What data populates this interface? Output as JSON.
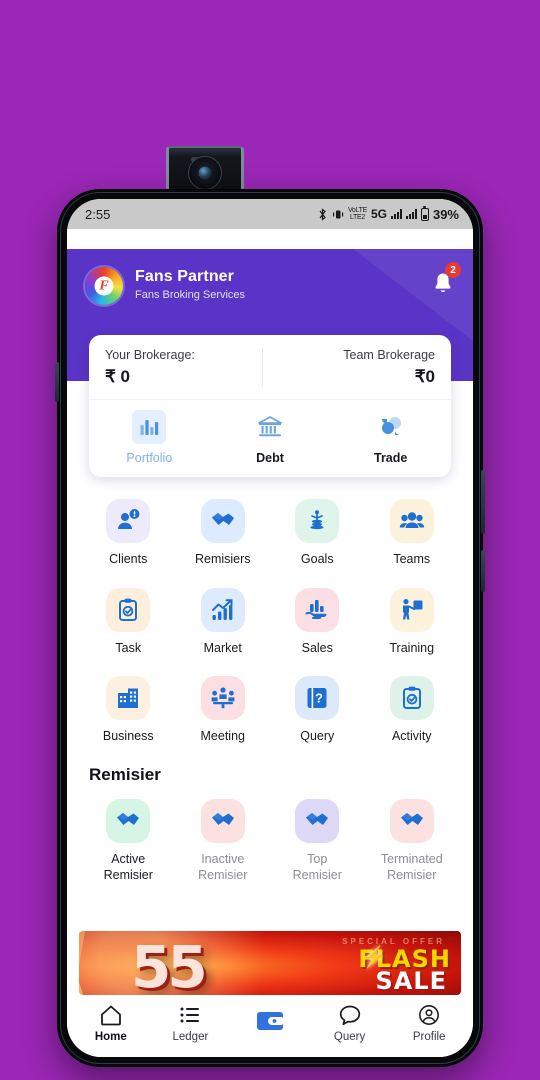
{
  "wallpaper_color": "#9A27B5",
  "statusbar": {
    "time": "2:55",
    "battery_pct": "39%",
    "network": "5G",
    "lte_label": "VoLTE",
    "icons": [
      "bluetooth-icon",
      "vibrate-icon",
      "volte-icon",
      "signal-icon",
      "signal-icon",
      "battery-icon"
    ]
  },
  "header": {
    "app_name": "Fans Partner",
    "subtitle": "Fans Broking Services",
    "logo_letter": "F",
    "notification_count": "2",
    "bg_color": "#5A34C6"
  },
  "brokerage": {
    "your_label": "Your Brokerage:",
    "your_value": "₹ 0",
    "team_label": "Team Brokerage",
    "team_value": "₹0"
  },
  "segment_tabs": [
    {
      "label": "Portfolio",
      "icon": "bar-chart-icon",
      "active": true
    },
    {
      "label": "Debt",
      "icon": "bank-icon",
      "active": false
    },
    {
      "label": "Trade",
      "icon": "bubbles-icon",
      "active": false
    }
  ],
  "menu_grid": [
    {
      "label": "Clients",
      "icon": "user-alert-icon",
      "tile": "#EDEBFA"
    },
    {
      "label": "Remisiers",
      "icon": "handshake-icon",
      "tile": "#DCEBFD"
    },
    {
      "label": "Goals",
      "icon": "goal-coins-icon",
      "tile": "#DFF5EC"
    },
    {
      "label": "Teams",
      "icon": "group-icon",
      "tile": "#FCF2DC"
    },
    {
      "label": "Task",
      "icon": "clipboard-check-icon",
      "tile": "#FDEFDB"
    },
    {
      "label": "Market",
      "icon": "trend-chart-icon",
      "tile": "#DDEBFC"
    },
    {
      "label": "Sales",
      "icon": "hand-chart-icon",
      "tile": "#FBDFE4"
    },
    {
      "label": "Training",
      "icon": "training-icon",
      "tile": "#FCF2DC"
    },
    {
      "label": "Business",
      "icon": "building-icon",
      "tile": "#FCF1E0"
    },
    {
      "label": "Meeting",
      "icon": "meeting-icon",
      "tile": "#FBDFE2"
    },
    {
      "label": "Query",
      "icon": "question-book-icon",
      "tile": "#DCE9F9"
    },
    {
      "label": "Activity",
      "icon": "activity-clipboard-icon",
      "tile": "#DFF2E9"
    }
  ],
  "remisier_section": {
    "title": "Remisier",
    "items": [
      {
        "label_line1": "Active",
        "label_line2": "Remisier",
        "icon": "handshake-icon",
        "tile": "#D6F5E4",
        "muted": false
      },
      {
        "label_line1": "Inactive",
        "label_line2": "Remisier",
        "icon": "handshake-icon",
        "tile": "#FBE2E0",
        "muted": true
      },
      {
        "label_line1": "Top",
        "label_line2": "Remisier",
        "icon": "handshake-icon",
        "tile": "#DCD8F6",
        "muted": true
      },
      {
        "label_line1": "Terminated",
        "label_line2": "Remisier",
        "icon": "handshake-icon",
        "tile": "#FBE2E0",
        "muted": true
      }
    ]
  },
  "banner": {
    "number": "55",
    "offer_text": "SPECIAL OFFER",
    "flash_text": "FLASH",
    "sale_text": "SALE"
  },
  "bottom_nav": [
    {
      "label": "Home",
      "icon": "home-icon",
      "active": true
    },
    {
      "label": "Ledger",
      "icon": "list-icon",
      "active": false
    },
    {
      "label": "",
      "icon": "wallet-icon",
      "active": false
    },
    {
      "label": "Query",
      "icon": "chat-icon",
      "active": false
    },
    {
      "label": "Profile",
      "icon": "profile-icon",
      "active": false
    }
  ]
}
